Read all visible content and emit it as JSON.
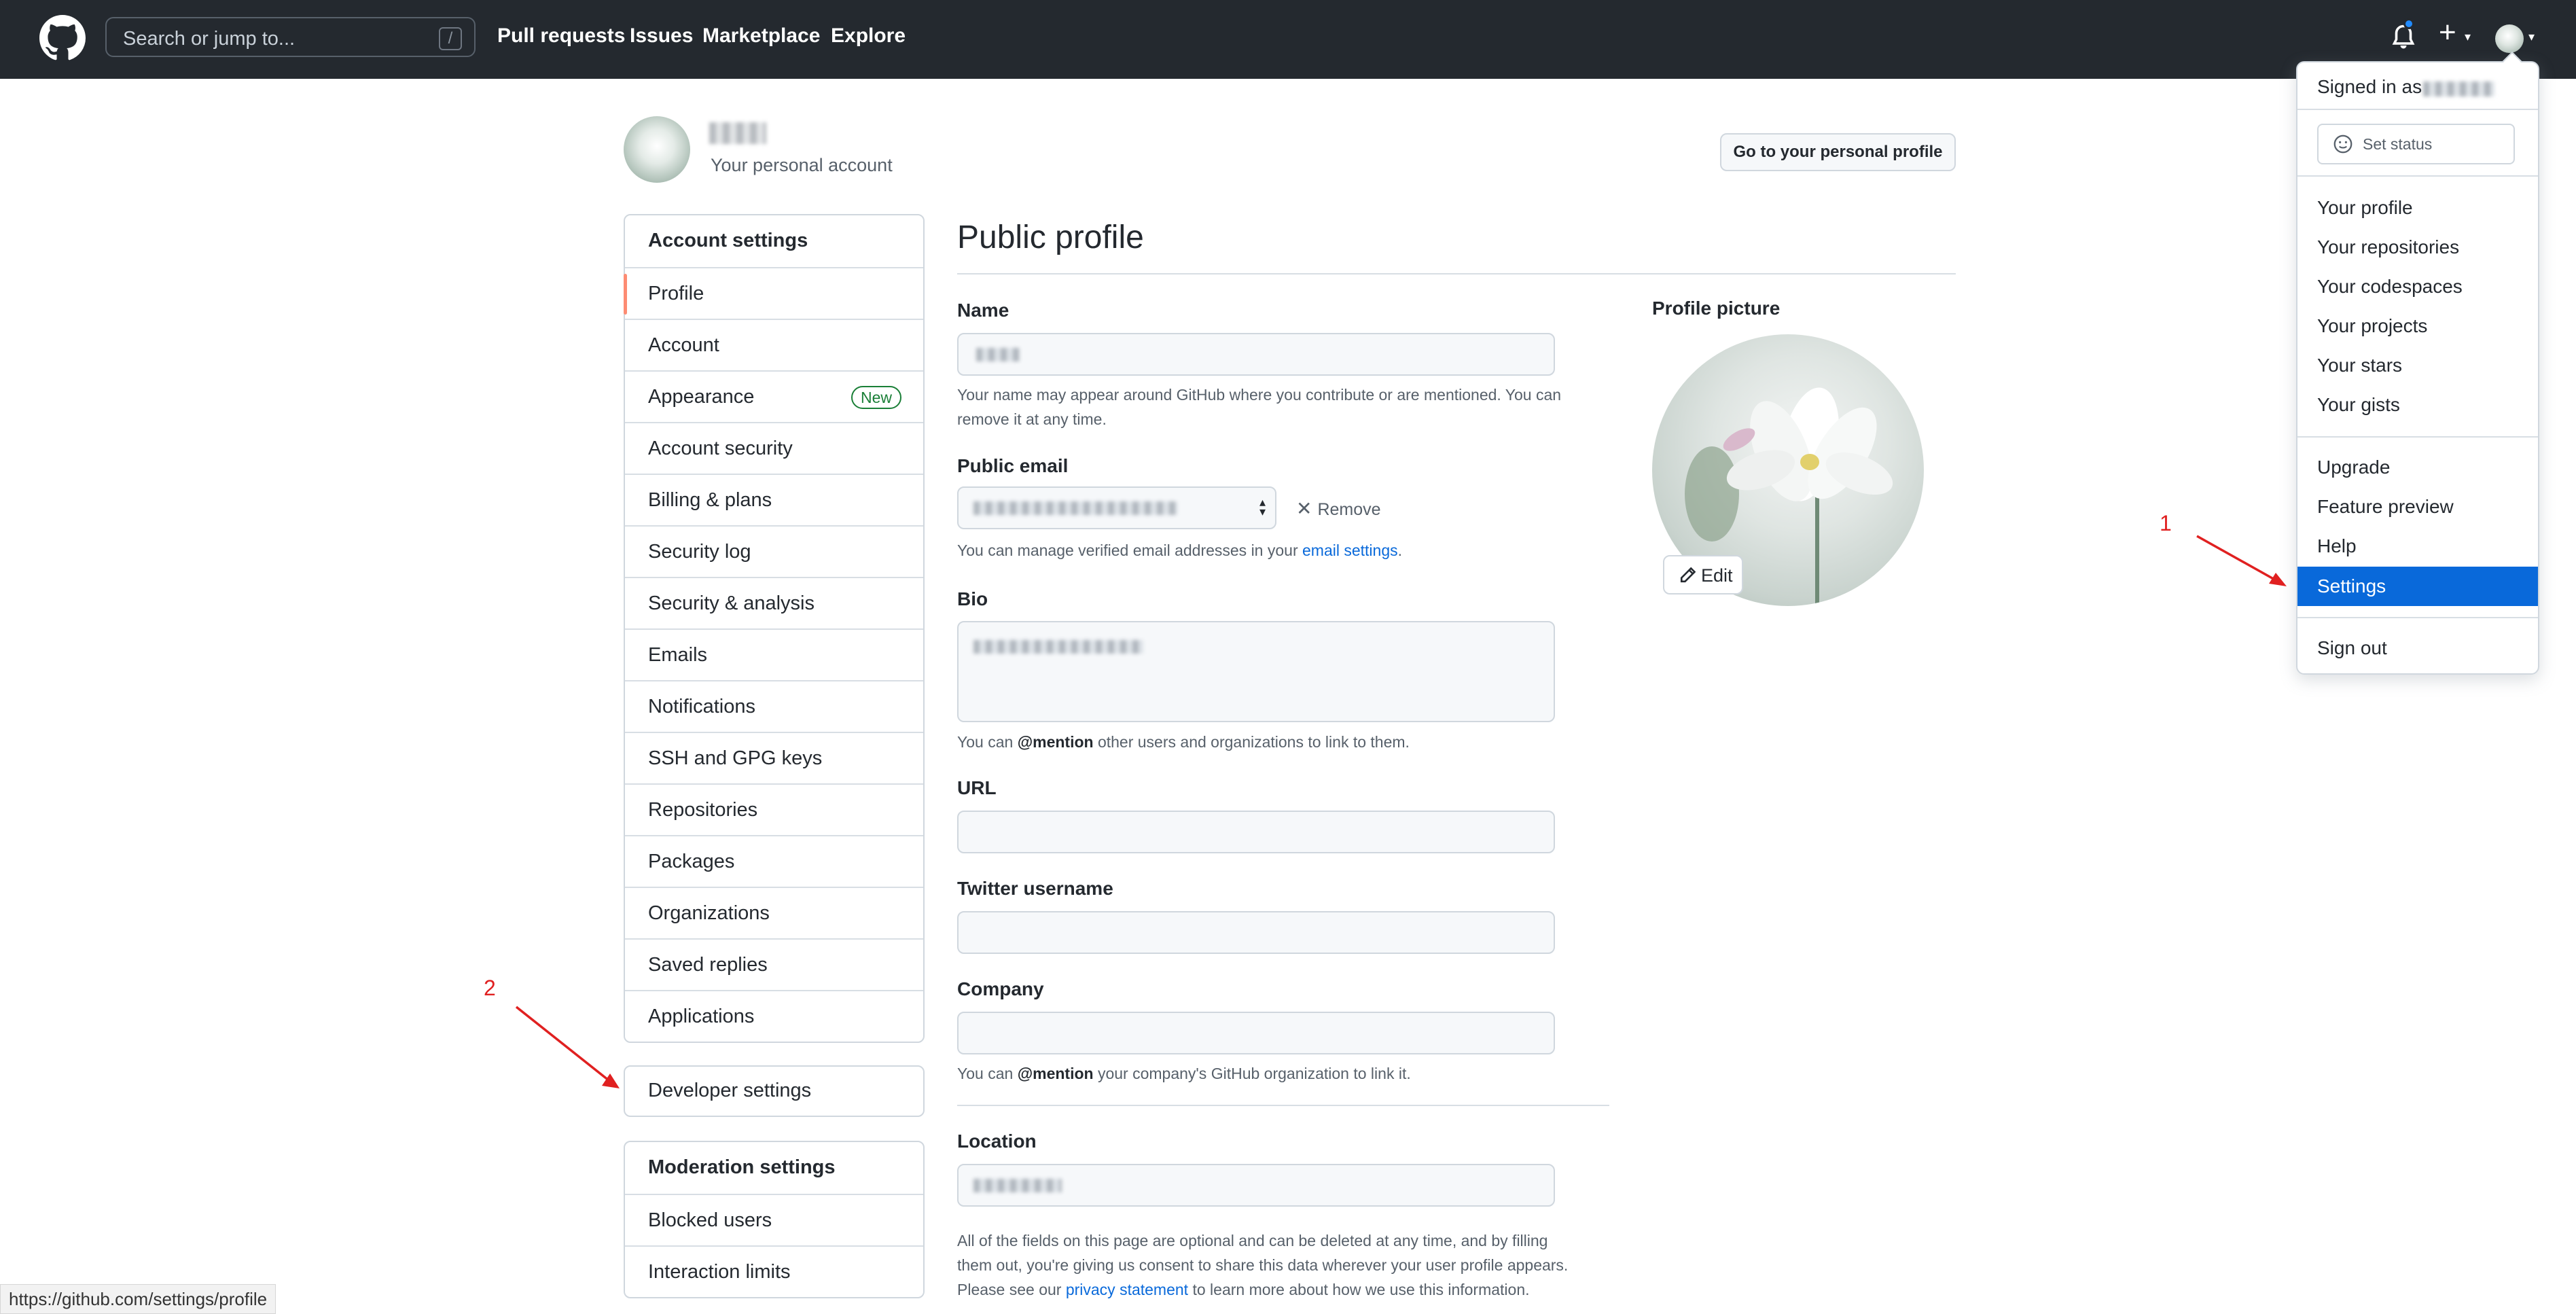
{
  "header": {
    "search_placeholder": "Search or jump to...",
    "search_shortcut": "/",
    "nav": [
      "Pull requests",
      "Issues",
      "Marketplace",
      "Explore"
    ]
  },
  "account": {
    "subtitle": "Your personal account",
    "go_profile_label": "Go to your personal profile"
  },
  "sidebar": {
    "account_settings": {
      "heading": "Account settings",
      "items": [
        "Profile",
        "Account",
        "Appearance",
        "Account security",
        "Billing & plans",
        "Security log",
        "Security & analysis",
        "Emails",
        "Notifications",
        "SSH and GPG keys",
        "Repositories",
        "Packages",
        "Organizations",
        "Saved replies",
        "Applications"
      ],
      "selected": "Profile",
      "new_badge": "New"
    },
    "developer_settings": "Developer settings",
    "moderation": {
      "heading": "Moderation settings",
      "items": [
        "Blocked users",
        "Interaction limits"
      ]
    }
  },
  "main": {
    "title": "Public profile",
    "name": {
      "label": "Name",
      "note": "Your name may appear around GitHub where you contribute or are mentioned. You can remove it at any time."
    },
    "public_email": {
      "label": "Public email",
      "remove_label": "Remove",
      "note_prefix": "You can manage verified email addresses in your ",
      "note_link": "email settings",
      "note_suffix": "."
    },
    "bio": {
      "label": "Bio",
      "note_prefix": "You can ",
      "note_mention": "@mention",
      "note_suffix": " other users and organizations to link to them."
    },
    "url": {
      "label": "URL"
    },
    "twitter": {
      "label": "Twitter username"
    },
    "company": {
      "label": "Company",
      "note_prefix": "You can ",
      "note_mention": "@mention",
      "note_suffix": " your company's GitHub organization to link it."
    },
    "location": {
      "label": "Location"
    },
    "footer": {
      "line1": "All of the fields on this page are optional and can be deleted at any time, and by filling",
      "line2": "them out, you're giving us consent to share this data wherever your user profile appears.",
      "line3_prefix": "Please see our ",
      "line3_link": "privacy statement",
      "line3_suffix": " to learn more about how we use this information."
    }
  },
  "profile_picture": {
    "label": "Profile picture",
    "edit_label": "Edit"
  },
  "user_menu": {
    "signed_in_as": "Signed in as",
    "set_status": "Set status",
    "group1": [
      "Your profile",
      "Your repositories",
      "Your codespaces",
      "Your projects",
      "Your stars",
      "Your gists"
    ],
    "group2": [
      "Upgrade",
      "Feature preview",
      "Help",
      "Settings"
    ],
    "active_item": "Settings",
    "sign_out": "Sign out"
  },
  "annotations": {
    "one": "1",
    "two": "2"
  },
  "status_bar": {
    "url": "https://github.com/settings/profile"
  },
  "colors": {
    "header_bg": "#24292f",
    "accent_blue": "#0969da",
    "selected_indicator": "#fd8c73",
    "new_badge": "#1a7f37",
    "annotation_red": "#e02020",
    "notification_dot": "#218bff"
  },
  "icons": [
    "github-logo-icon",
    "bell-icon",
    "plus-icon",
    "chevron-down-icon",
    "smiley-icon",
    "pencil-icon",
    "close-icon",
    "select-arrows-icon"
  ]
}
